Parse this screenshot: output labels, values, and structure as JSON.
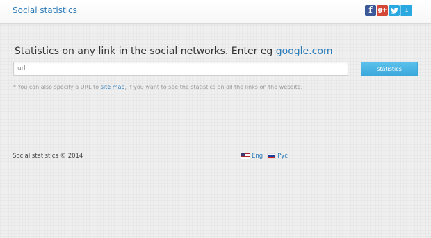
{
  "header": {
    "brand": "Social statistics",
    "social": {
      "facebook_glyph": "f",
      "googleplus_glyph": "g+",
      "twitter_glyph": "t",
      "twitter_count": "1"
    }
  },
  "main": {
    "headline_text": "Statistics on any link in the social networks. Enter eg ",
    "headline_link": "google.com",
    "search": {
      "placeholder": "url",
      "button_label": "statistics"
    },
    "hint": {
      "prefix": "* You can also specify a URL to ",
      "link": "site map",
      "suffix": ", if you want to see the statistics on all the links on the website."
    }
  },
  "footer": {
    "copyright": "Social statistics © 2014",
    "languages": [
      {
        "label": "Eng",
        "flag": "us-flag-icon"
      },
      {
        "label": "Рус",
        "flag": "ru-flag-icon"
      }
    ]
  },
  "colors": {
    "link": "#2a7ab8",
    "button": "#3aa8dc",
    "background": "#efefef"
  }
}
